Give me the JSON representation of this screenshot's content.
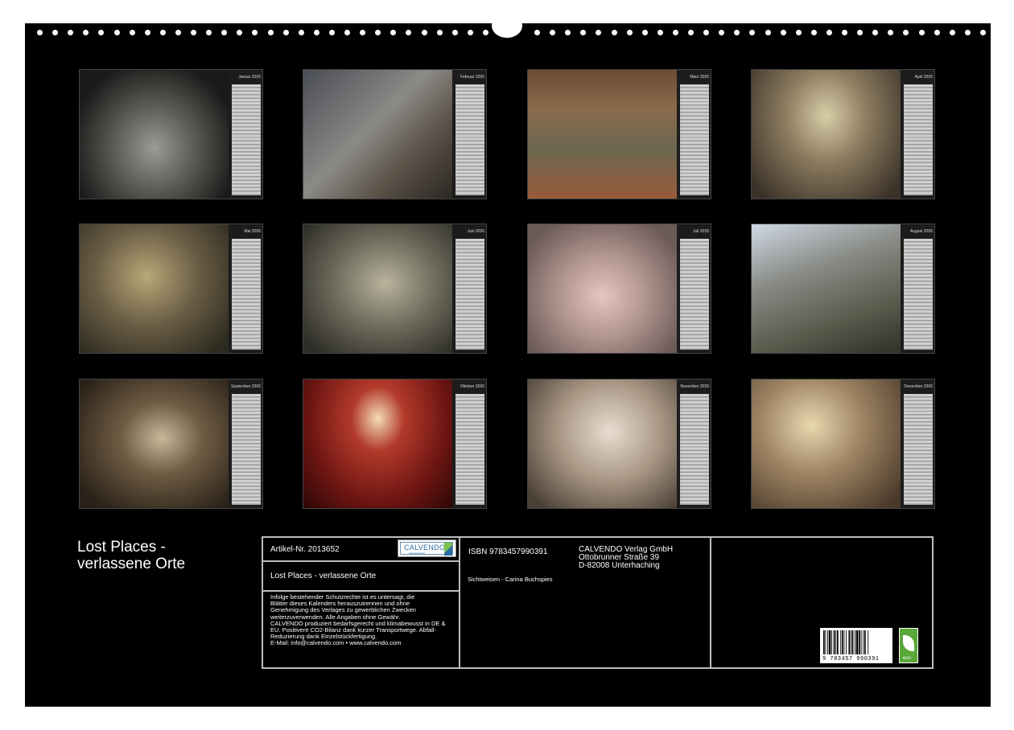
{
  "calendar": {
    "months": [
      {
        "name": "Januar 2026",
        "scene": "hall"
      },
      {
        "name": "Februar 2026",
        "scene": "stairs"
      },
      {
        "name": "März 2026",
        "scene": "theater"
      },
      {
        "name": "April 2026",
        "scene": "attic-room"
      },
      {
        "name": "Mai 2026",
        "scene": "ruin-room"
      },
      {
        "name": "Juni 2026",
        "scene": "kitchen"
      },
      {
        "name": "Juli 2026",
        "scene": "bedroom"
      },
      {
        "name": "August 2026",
        "scene": "glass-roof"
      },
      {
        "name": "September 2026",
        "scene": "corridor"
      },
      {
        "name": "Oktober 2026",
        "scene": "red-room"
      },
      {
        "name": "November 2026",
        "scene": "bathroom"
      },
      {
        "name": "Dezember 2026",
        "scene": "chapel"
      }
    ]
  },
  "title": {
    "line1": "Lost Places -",
    "line2": "verlassene Orte"
  },
  "info": {
    "article": "Artikel-Nr. 2013652",
    "product_title": "Lost Places - verlassene Orte",
    "legal": [
      "Infolge bestehender Schutzrechte ist es untersagt, die",
      "Blätter dieses Kalenders herauszutrennen und ohne",
      "Genehmigung des Verlages zu gewerblichen Zwecken",
      "weiterzuverwenden. Alle Angaben ohne Gewähr.",
      "CALVENDO produziert bedarfsgerecht und klimabewusst in DE &",
      "EU. Positivere CO2-Bilanz dank kurzer Transportwege. Abfall-",
      "Reduzierung dank Einzelstückfertigung.",
      "E-Mail: info@calvendo.com • www.calvendo.com"
    ],
    "isbn": "ISBN 9783457990391",
    "author": "Sichtweisen - Carina Buchspies",
    "publisher": [
      "CALVENDO Verlag GmbH",
      "Ottobrunner Straße 39",
      "D-82008 Unterhaching"
    ],
    "logo_word": "CALVENDO",
    "logo_sub": "Kalenderverlag",
    "barcode_number": "9 783457 990391",
    "eco_label": "eco"
  },
  "colors": {
    "page": "#000000",
    "border": "#bdbdbd",
    "eco": "#5aa83a",
    "brand": "#2b6ca3"
  }
}
